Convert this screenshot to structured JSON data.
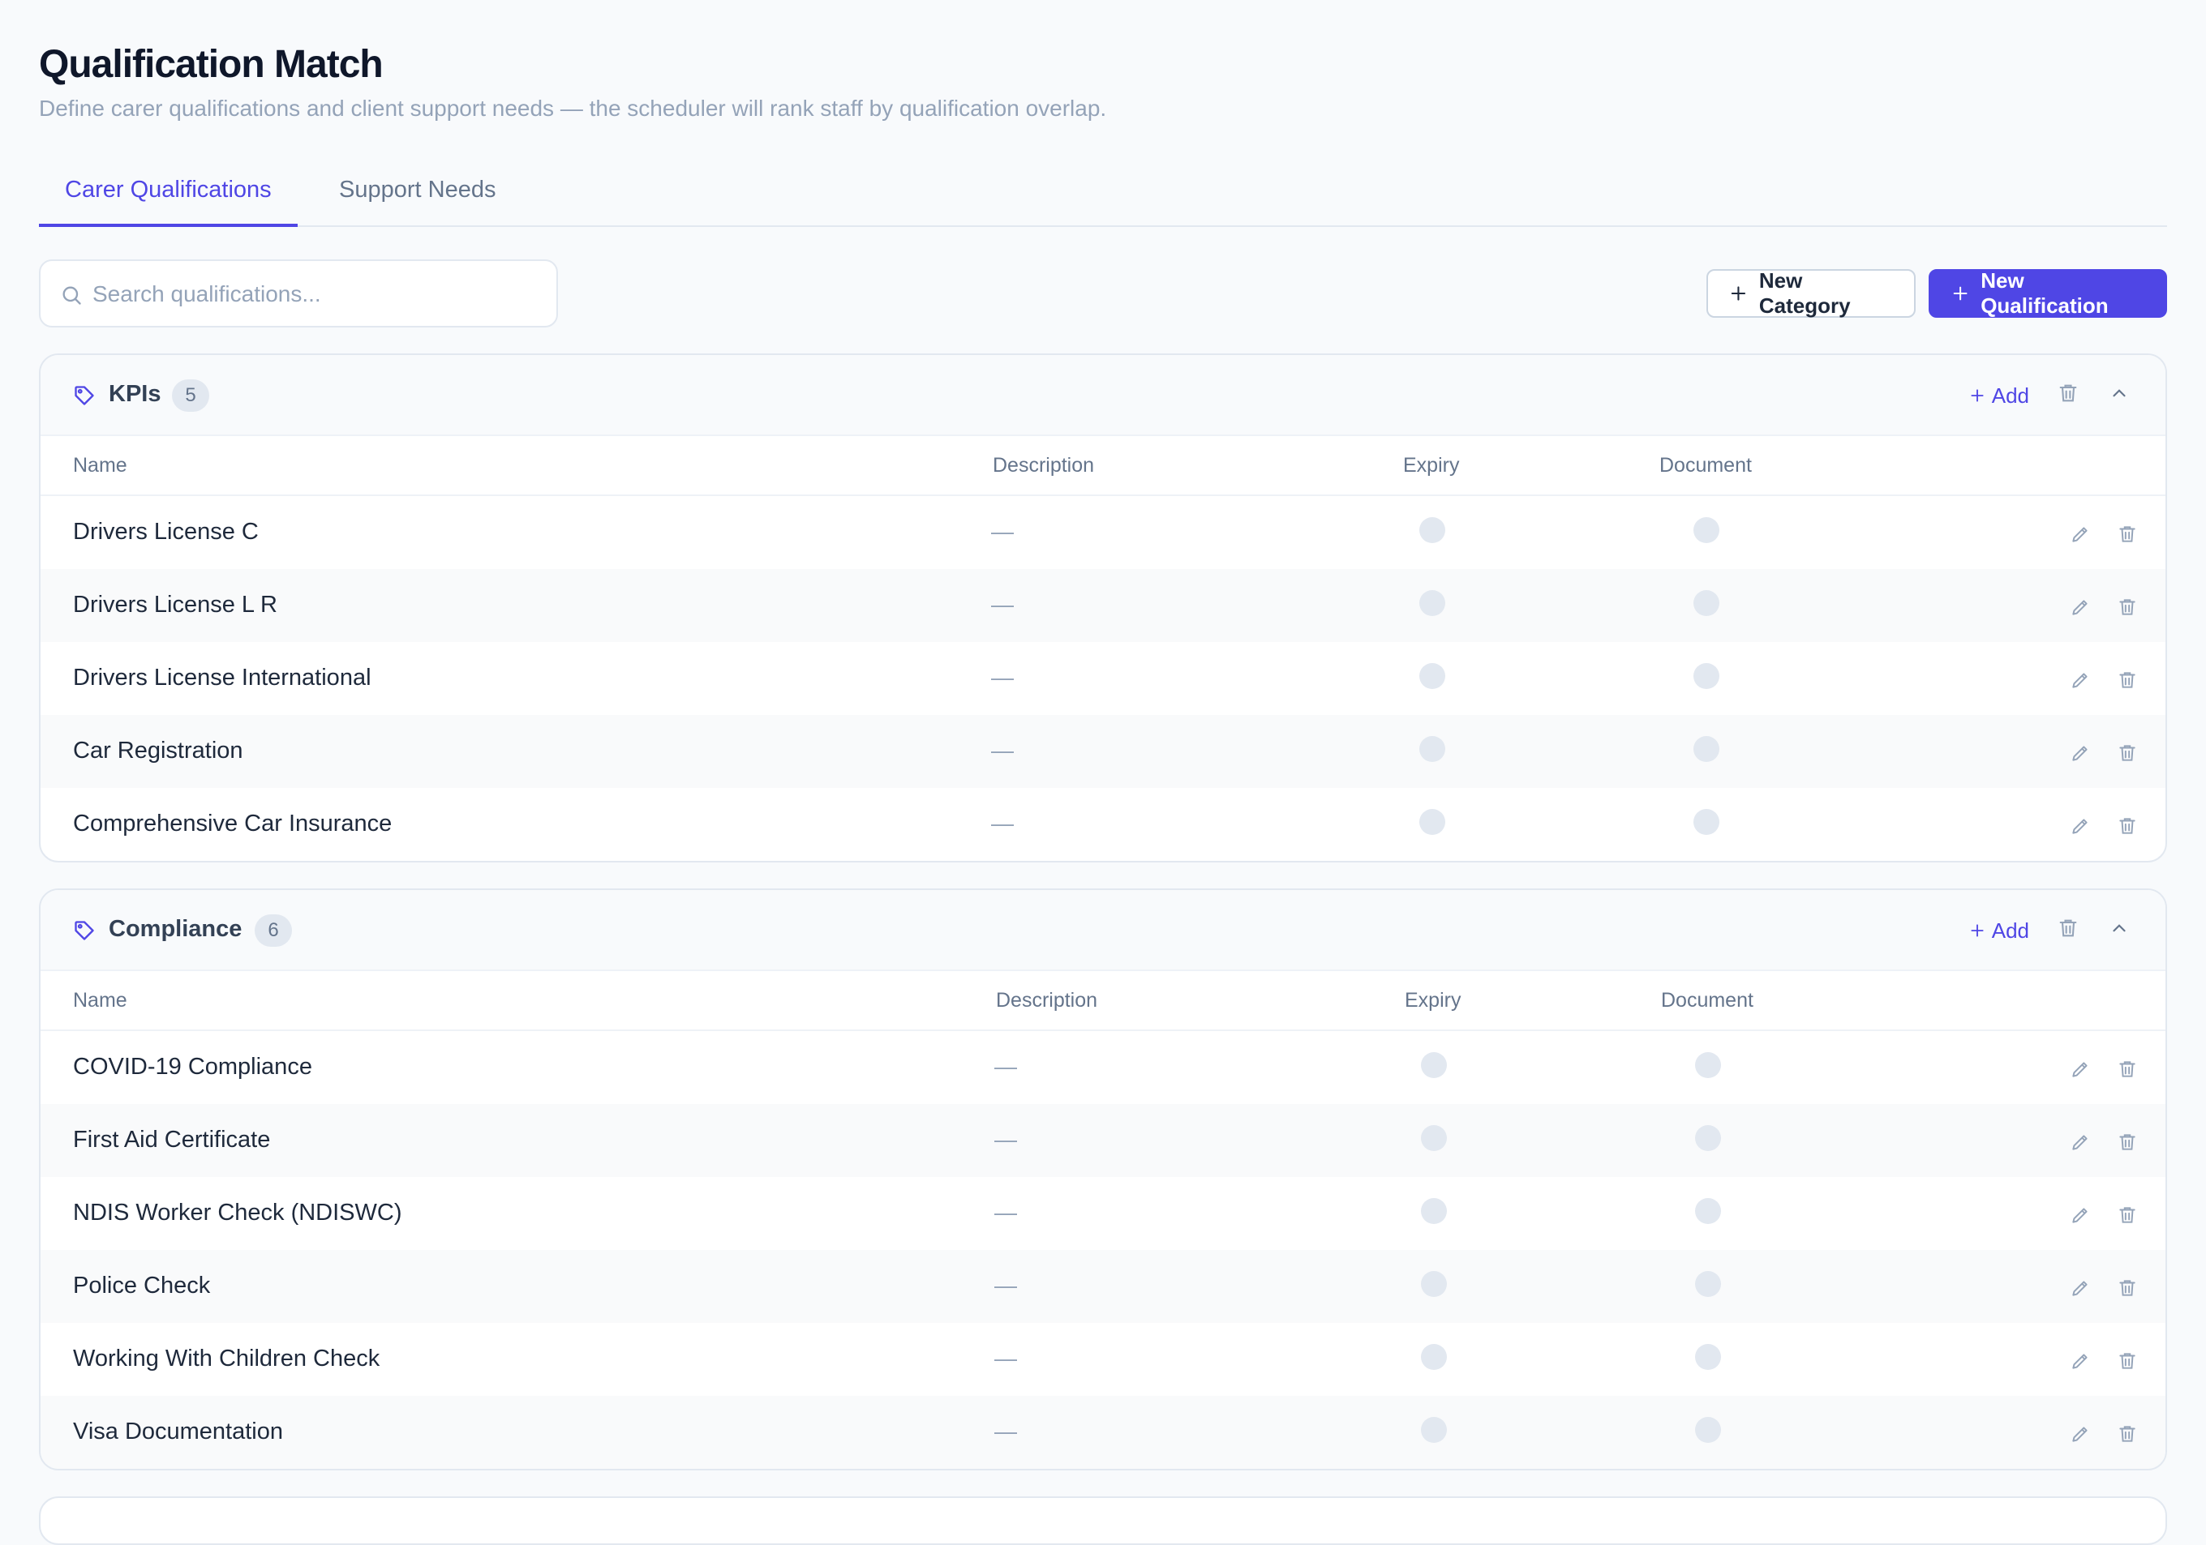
{
  "page": {
    "title": "Qualification Match",
    "subtitle": "Define carer qualifications and client support needs — the scheduler will rank staff by qualification overlap."
  },
  "tabs": [
    {
      "label": "Carer Qualifications",
      "active": true
    },
    {
      "label": "Support Needs",
      "active": false
    }
  ],
  "toolbar": {
    "search_placeholder": "Search qualifications...",
    "search_value": "",
    "new_category_label": "New Category",
    "new_qualification_label": "New Qualification"
  },
  "columns": {
    "name": "Name",
    "description": "Description",
    "expiry": "Expiry",
    "document": "Document"
  },
  "categories": [
    {
      "name": "KPIs",
      "count": "5",
      "add_label": "Add",
      "items": [
        {
          "name": "Drivers License C",
          "description": "—"
        },
        {
          "name": "Drivers License L R",
          "description": "—"
        },
        {
          "name": "Drivers License International",
          "description": "—"
        },
        {
          "name": "Car Registration",
          "description": "—"
        },
        {
          "name": "Comprehensive Car Insurance",
          "description": "—"
        }
      ]
    },
    {
      "name": "Compliance",
      "count": "6",
      "add_label": "Add",
      "items": [
        {
          "name": "COVID-19 Compliance",
          "description": "—"
        },
        {
          "name": "First Aid Certificate",
          "description": "—"
        },
        {
          "name": "NDIS Worker Check (NDISWC)",
          "description": "—"
        },
        {
          "name": "Police Check",
          "description": "—"
        },
        {
          "name": "Working With Children Check",
          "description": "—"
        },
        {
          "name": "Visa Documentation",
          "description": "—"
        }
      ]
    }
  ],
  "colors": {
    "accent": "#4f46e5",
    "muted": "#94a3b8",
    "toggle_off": "#e2e8f0"
  },
  "icons": {
    "search": "search-icon",
    "plus": "plus-icon",
    "tag": "tag-icon",
    "trash": "trash-icon",
    "chevron": "chevron-up-icon",
    "edit": "pencil-icon"
  }
}
